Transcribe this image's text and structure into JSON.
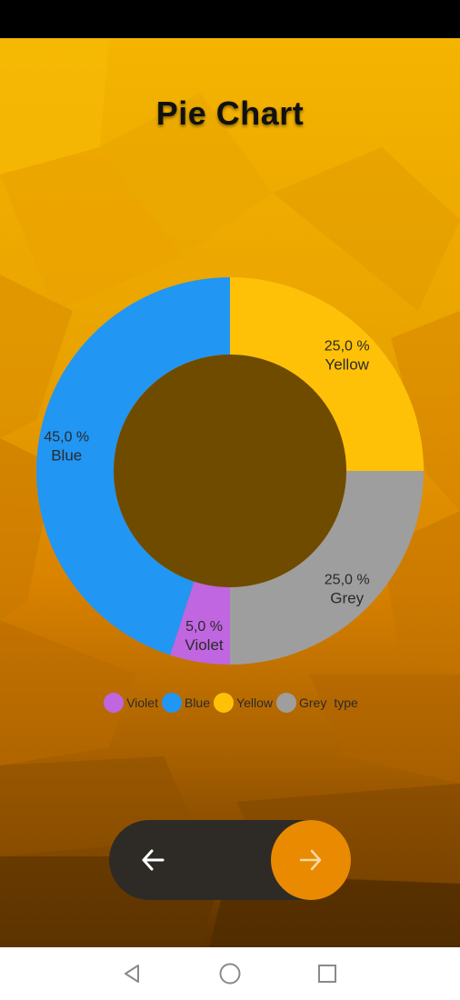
{
  "page": {
    "title": "Pie Chart"
  },
  "chart_data": {
    "type": "pie",
    "style": "donut",
    "title": "Pie Chart",
    "legend_placement": "bottom",
    "legend_suffix": "type",
    "slices": [
      {
        "name": "Violet",
        "value": 5.0,
        "label": "5,0 %",
        "color": "#c066e0"
      },
      {
        "name": "Blue",
        "value": 45.0,
        "label": "45,0 %",
        "color": "#2196f3"
      },
      {
        "name": "Yellow",
        "value": 25.0,
        "label": "25,0 %",
        "color": "#ffc107"
      },
      {
        "name": "Grey",
        "value": 25.0,
        "label": "25,0 %",
        "color": "#9e9e9e"
      }
    ]
  },
  "nav": {
    "back_icon": "arrow-left-icon",
    "next_icon": "arrow-right-icon",
    "next_color": "#e98a00"
  },
  "system_nav": {
    "back_icon": "triangle-back-icon",
    "home_icon": "circle-home-icon",
    "recents_icon": "square-recents-icon"
  },
  "colors": {
    "background": "#e9a000",
    "hole": "#6f4b00",
    "pill": "#2e2b27"
  }
}
